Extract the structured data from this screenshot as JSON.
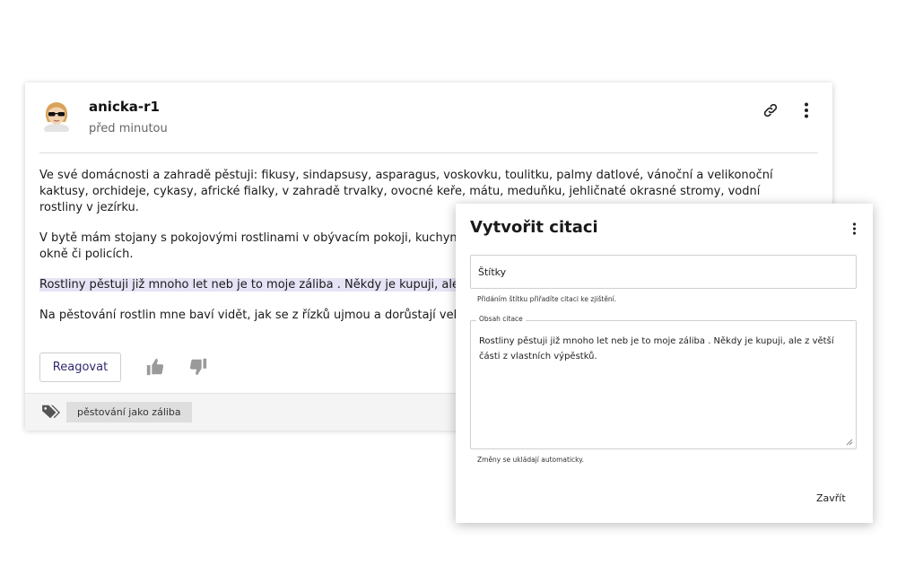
{
  "post": {
    "username": "anicka-r1",
    "timestamp": "před minutou",
    "paragraphs": [
      "Ve své domácnosti a zahradě pěstuji: fikusy, sindapsusy, asparagus, voskovku, toulitku, palmy datlové, vánoční a velikonoční kaktusy, orchideje, cykasy, africké fialky, v zahradě trvalky, ovocné keře, mátu, meduňku, jehličnaté okrasné stromy, vodní rostliny v jezírku.",
      "V bytě mám stojany s pokojovými rostlinami v obývacím pokoji, kuchyni.",
      "okně či policích.",
      "Rostliny pěstuji již mnoho let neb je to moje záliba . Někdy je kupuji, ale z v",
      "Na pěstování rostlin mne baví vidět, jak se z řízků ujmou a dorůstají velký"
    ],
    "reply_label": "Reagovat",
    "tag": "pěstování jako záliba"
  },
  "icons": {
    "link": "link-icon",
    "more": "more-vertical-icon",
    "thumb_up": "thumb-up-icon",
    "thumb_down": "thumb-down-icon",
    "tag": "tags-icon"
  },
  "modal": {
    "title": "Vytvořit citaci",
    "tags_placeholder": "Štítky",
    "tags_helper": "Přidáním štítku přiřadíte citaci ke zjištění.",
    "content_label": "Obsah citace",
    "content_value": "Rostliny pěstuji již mnoho let neb je to moje záliba . Někdy je kupuji, ale z větší části z vlastních výpěstků.",
    "autosave_note": "Změny se ukládají automaticky.",
    "close_label": "Zavřít"
  },
  "colors": {
    "accent": "#2e2a6e",
    "highlight": "#e6e3f6",
    "muted": "#666666"
  }
}
